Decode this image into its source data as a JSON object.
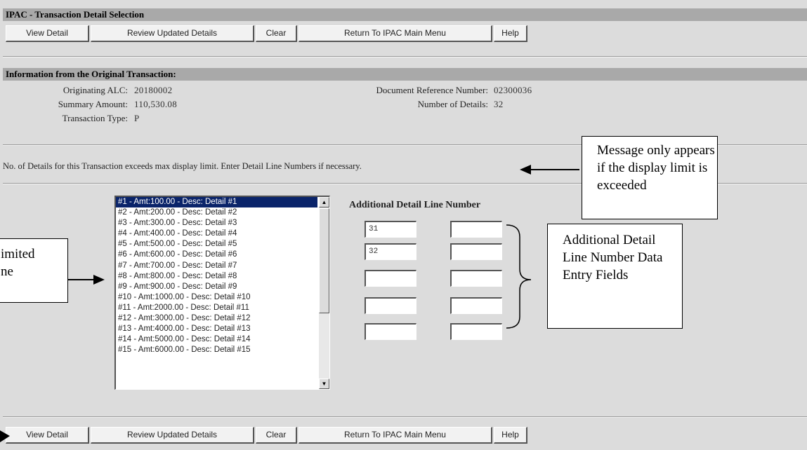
{
  "window": {
    "title": "IPAC - Transaction Detail Selection"
  },
  "toolbar": {
    "view_detail": "View Detail",
    "review_updated": "Review Updated Details",
    "clear": "Clear",
    "return_main": "Return To IPAC Main Menu",
    "help": "Help"
  },
  "original_transaction": {
    "heading": "Information from the Original Transaction:",
    "originating_alc_label": "Originating ALC:",
    "originating_alc_value": "20180002",
    "summary_amount_label": "Summary Amount:",
    "summary_amount_value": "110,530.08",
    "transaction_type_label": "Transaction Type:",
    "transaction_type_value": "P",
    "doc_ref_label": "Document Reference Number:",
    "doc_ref_value": "02300036",
    "num_details_label": "Number of Details:",
    "num_details_value": "32"
  },
  "notice": "No. of Details for this Transaction exceeds max display limit. Enter Detail Line Numbers if necessary.",
  "detail_list": {
    "items": [
      "#1 - Amt:100.00 - Desc: Detail #1",
      "#2 - Amt:200.00 - Desc: Detail #2",
      "#3 - Amt:300.00 - Desc: Detail #3",
      "#4 - Amt:400.00 - Desc: Detail #4",
      "#5 - Amt:500.00 - Desc: Detail #5",
      "#6 - Amt:600.00 - Desc: Detail #6",
      "#7 - Amt:700.00 - Desc: Detail #7",
      "#8 - Amt:800.00 - Desc: Detail #8",
      "#9 - Amt:900.00 - Desc: Detail #9",
      "#10 - Amt:1000.00 - Desc: Detail #10",
      "#11 - Amt:2000.00 - Desc: Detail #11",
      "#12 - Amt:3000.00 - Desc: Detail #12",
      "#13 - Amt:4000.00 - Desc: Detail #13",
      "#14 - Amt:5000.00 - Desc: Detail #14",
      "#15 - Amt:6000.00 - Desc: Detail #15"
    ],
    "selected_index": 0
  },
  "additional_detail": {
    "heading": "Additional Detail Line Number",
    "fields": [
      "31",
      "",
      "32",
      "",
      "",
      "",
      "",
      "",
      "",
      ""
    ]
  },
  "callouts": {
    "message_only": "Message only appears if the display limit is exceeded",
    "additional_fields": "Additional Detail Line Number Data Entry Fields",
    "limited_partial_1": "imited",
    "limited_partial_2": "ne"
  },
  "colors": {
    "background": "#dcdcdc",
    "header_bar": "#a9a9a9",
    "selection": "#0a246a"
  },
  "icons": {
    "scroll_up": "scroll-up-arrow-icon",
    "scroll_down": "scroll-down-arrow-icon"
  }
}
